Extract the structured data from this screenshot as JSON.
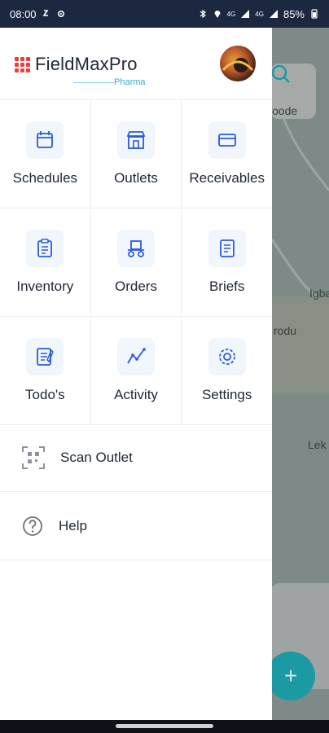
{
  "status_bar": {
    "time": "08:00",
    "battery": "85%",
    "network_a": "4G",
    "network_b": "4G"
  },
  "header": {
    "brand": "FieldMaxPro",
    "sub_brand": "Pharma",
    "avatar_icon": "avatar-photo"
  },
  "menu": {
    "rows": [
      [
        {
          "label": "Schedules",
          "icon": "calendar-icon"
        },
        {
          "label": "Outlets",
          "icon": "store-icon"
        },
        {
          "label": "Receivables",
          "icon": "card-icon"
        }
      ],
      [
        {
          "label": "Inventory",
          "icon": "clipboard-icon"
        },
        {
          "label": "Orders",
          "icon": "delivery-icon"
        },
        {
          "label": "Briefs",
          "icon": "document-icon"
        }
      ],
      [
        {
          "label": "Todo's",
          "icon": "todo-icon"
        },
        {
          "label": "Activity",
          "icon": "activity-icon"
        },
        {
          "label": "Settings",
          "icon": "gear-icon"
        }
      ]
    ]
  },
  "list": {
    "scan_outlet": "Scan Outlet",
    "help": "Help"
  },
  "map": {
    "labels": [
      "oode",
      "Igba",
      "rodu",
      "Lek"
    ]
  },
  "colors": {
    "accent": "#2a5bd7",
    "brand_red": "#e8413c",
    "sub_brand": "#38a9d8",
    "fab": "#1b9aa3",
    "status_bar": "#1c2740"
  }
}
